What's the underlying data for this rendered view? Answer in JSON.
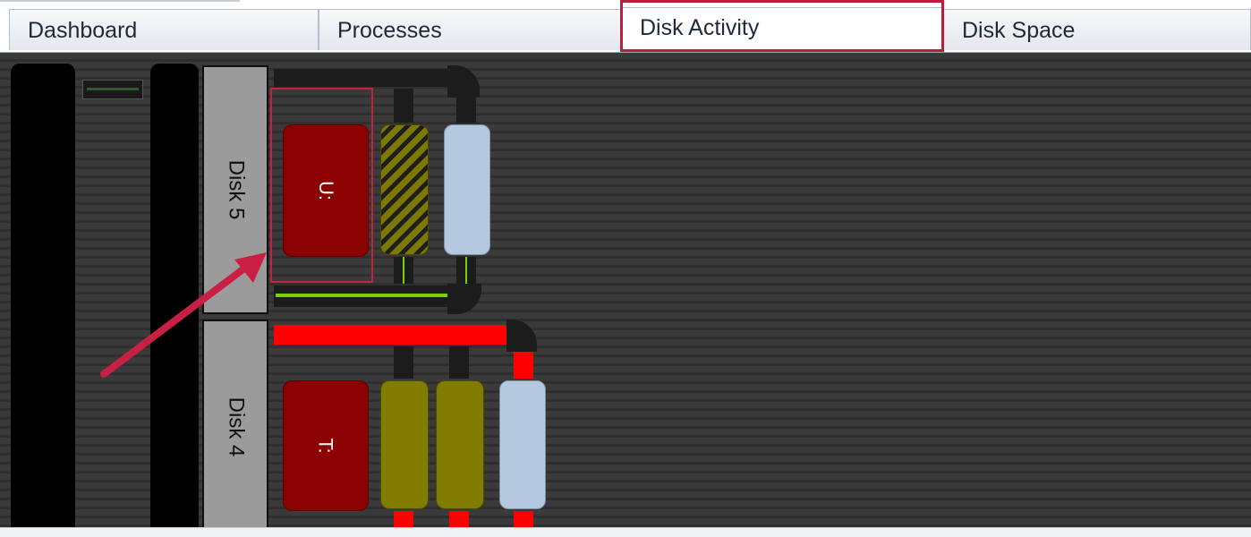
{
  "tabs": [
    {
      "label": "Dashboard",
      "active": false
    },
    {
      "label": "Processes",
      "active": false
    },
    {
      "label": "Disk Activity",
      "active": true
    },
    {
      "label": "Disk Space",
      "active": false
    }
  ],
  "disks": [
    {
      "label": "Disk 5",
      "volume": "U:"
    },
    {
      "label": "Disk 4",
      "volume": "T:"
    }
  ],
  "colors": {
    "highlight": "#c0243f",
    "volume": "#8b0000",
    "activity_high": "#ff0000",
    "activity_low": "#7cd100",
    "cache": "#807c00",
    "queue": "#b4c8e0"
  }
}
